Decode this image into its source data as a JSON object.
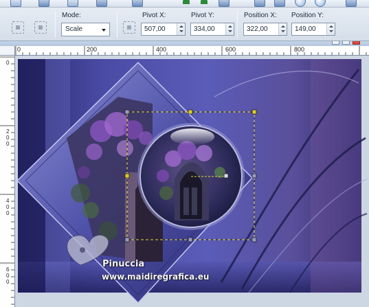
{
  "options": {
    "mode_label": "Mode:",
    "mode_value": "Scale",
    "pivot_x_label": "Pivot X:",
    "pivot_x_value": "507,00",
    "pivot_y_label": "Pivot Y:",
    "pivot_y_value": "334,00",
    "position_x_label": "Position X:",
    "position_x_value": "322,00",
    "position_y_label": "Position Y:",
    "position_y_value": "149,00"
  },
  "ruler": {
    "h_labels": [
      "0",
      "200",
      "400",
      "600",
      "800"
    ],
    "v_labels": [
      "0",
      "200",
      "400",
      "600"
    ]
  },
  "watermark": {
    "name": "Pinuccia",
    "url": "www.maidiregrafica.eu"
  },
  "colors": {
    "canvas_base": "#3b3d8c",
    "canvas_light": "#8d8fd4",
    "canvas_dark": "#1b1b52",
    "selection_dash": "#e3d54a",
    "handle": "#9a9ac8",
    "pivot_handle": "#e0cc2a"
  }
}
